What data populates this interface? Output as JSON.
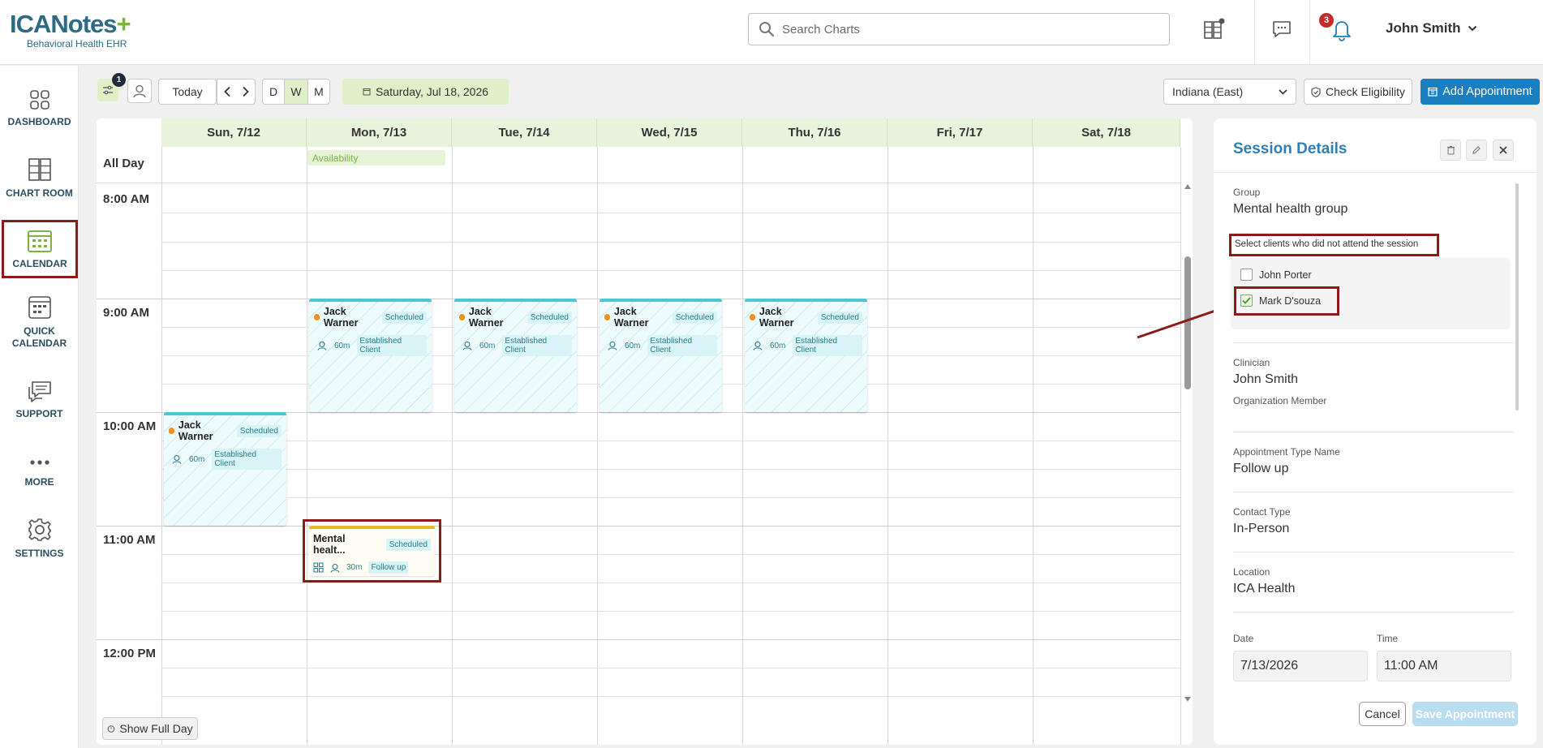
{
  "header": {
    "logo_text": "ICANotes",
    "logo_plus": "+",
    "logo_sub": "Behavioral Health EHR",
    "search_placeholder": "Search Charts",
    "notification_count": "3",
    "user_name": "John Smith"
  },
  "sidebar": {
    "items": [
      {
        "label": "DASHBOARD"
      },
      {
        "label": "CHART ROOM"
      },
      {
        "label": "CALENDAR"
      },
      {
        "label": "QUICK\nCALENDAR"
      },
      {
        "label": "SUPPORT"
      },
      {
        "label": "MORE"
      },
      {
        "label": "SETTINGS"
      }
    ]
  },
  "toolbar": {
    "filter_badge": "1",
    "today_label": "Today",
    "view_d": "D",
    "view_w": "W",
    "view_m": "M",
    "date_label": "Saturday, Jul 18, 2026",
    "timezone": "Indiana (East)",
    "check_eligibility": "Check Eligibility",
    "add_appointment": "Add Appointment"
  },
  "calendar": {
    "days": [
      "Sun, 7/12",
      "Mon, 7/13",
      "Tue, 7/14",
      "Wed, 7/15",
      "Thu, 7/16",
      "Fri, 7/17",
      "Sat, 7/18"
    ],
    "all_day_label": "All Day",
    "availability_label": "Availability",
    "times": [
      "8:00 AM",
      "9:00 AM",
      "10:00 AM",
      "11:00 AM",
      "12:00 PM"
    ],
    "show_full_day": "Show Full Day",
    "appointments": [
      {
        "name": "Jack Warner",
        "status": "Scheduled",
        "duration": "60m",
        "type": "Established Client"
      },
      {
        "name": "Jack Warner",
        "status": "Scheduled",
        "duration": "60m",
        "type": "Established Client"
      },
      {
        "name": "Jack Warner",
        "status": "Scheduled",
        "duration": "60m",
        "type": "Established Client"
      },
      {
        "name": "Jack Warner",
        "status": "Scheduled",
        "duration": "60m",
        "type": "Established Client"
      },
      {
        "name": "Jack Warner",
        "status": "Scheduled",
        "duration": "60m",
        "type": "Established Client"
      }
    ],
    "group_appt": {
      "name": "Mental healt...",
      "status": "Scheduled",
      "duration": "30m",
      "type": "Follow up"
    }
  },
  "panel": {
    "title": "Session Details",
    "group_label": "Group",
    "group_value": "Mental health group",
    "attend_prompt": "Select clients who did not attend the session",
    "clients": [
      {
        "name": "John Porter",
        "checked": false
      },
      {
        "name": "Mark D'souza",
        "checked": true
      }
    ],
    "clinician_label": "Clinician",
    "clinician_value": "John Smith",
    "org_member_label": "Organization Member",
    "appt_type_label": "Appointment Type Name",
    "appt_type_value": "Follow up",
    "contact_type_label": "Contact Type",
    "contact_type_value": "In-Person",
    "location_label": "Location",
    "location_value": "ICA Health",
    "date_label": "Date",
    "date_value": "7/13/2026",
    "time_label": "Time",
    "time_value": "11:00 AM",
    "cancel_label": "Cancel",
    "save_label": "Save Appointment"
  },
  "colors": {
    "accent_green": "#7bb442",
    "accent_blue": "#1a7fc1",
    "annotation_red": "#8b1a1a",
    "appt_teal": "#49c9d4",
    "group_yellow": "#f0b429"
  }
}
